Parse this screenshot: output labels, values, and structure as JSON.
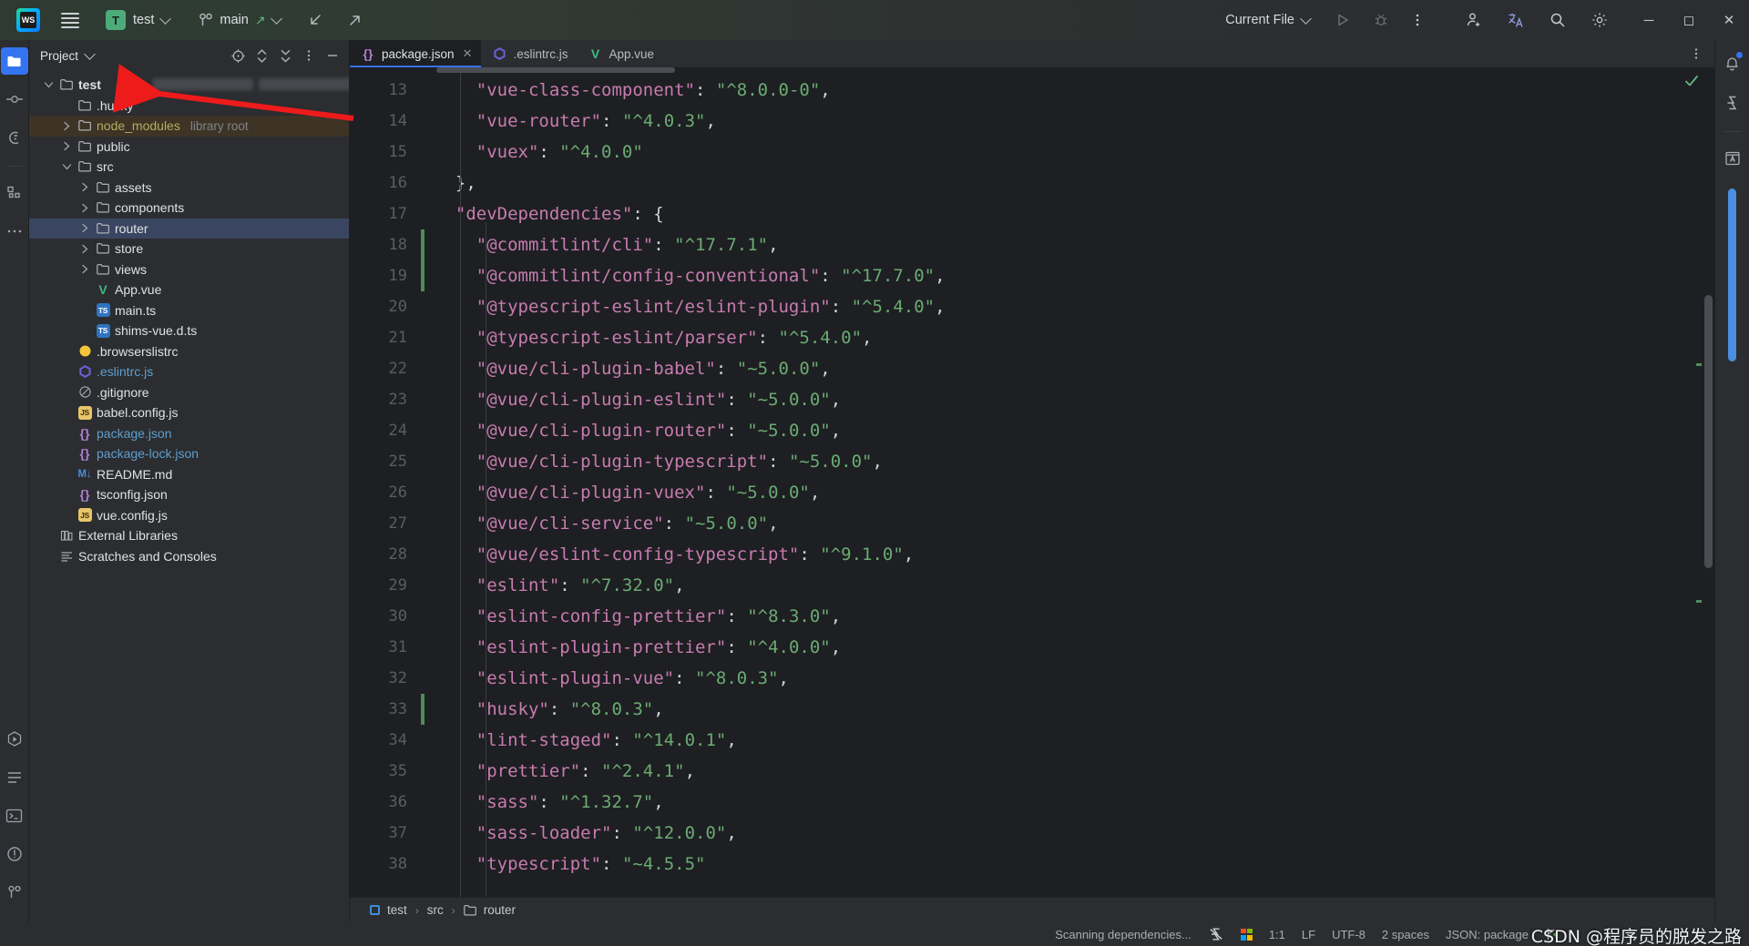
{
  "titlebar": {
    "app_icon": "webstorm-logo",
    "menu_icon": "hamburger-menu-icon",
    "project_badge": "T",
    "project_name": "test",
    "vcs_icon": "git-branch-icon",
    "branch_name": "main",
    "push_icon": "arrow-up-right-icon",
    "update_icon": "arrow-down-left-icon",
    "share_icon": "arrow-up-right-icon",
    "run_config_label": "Current File",
    "run_icon": "run-triangle-icon",
    "debug_icon": "debug-bug-icon",
    "more_icon": "more-vertical-icon",
    "account_icon": "add-user-icon",
    "translate_icon": "translate-icon",
    "search_icon": "search-icon",
    "settings_icon": "gear-icon",
    "minimize_icon": "minimize-icon",
    "maximize_icon": "maximize-icon",
    "close_icon": "close-icon"
  },
  "left_rail": {
    "top": [
      {
        "name": "project-tool-window",
        "icon": "folder-icon",
        "active": true
      },
      {
        "name": "commit-tool-window",
        "icon": "commit-node-icon",
        "active": false
      },
      {
        "name": "cyclone-tool-window",
        "icon": "cyclone-icon",
        "active": false
      },
      {
        "name": "structure-tool-window",
        "icon": "structure-blocks-icon",
        "active": false
      },
      {
        "name": "more-tool-windows",
        "icon": "ellipsis-icon",
        "active": false
      }
    ],
    "bottom": [
      {
        "name": "run-tool-window",
        "icon": "run-hex-icon"
      },
      {
        "name": "todo-tool-window",
        "icon": "lines-icon"
      },
      {
        "name": "terminal-tool-window",
        "icon": "terminal-icon"
      },
      {
        "name": "problems-tool-window",
        "icon": "warning-circle-icon"
      },
      {
        "name": "git-tool-window",
        "icon": "git-branch-icon"
      }
    ]
  },
  "project_panel": {
    "title": "Project",
    "title_chevron": "chevron-down-icon",
    "actions": [
      {
        "name": "select-opened-file",
        "icon": "target-icon"
      },
      {
        "name": "expand-collapse",
        "icon": "expand-collapse-icon"
      },
      {
        "name": "collapse-all",
        "icon": "collapse-all-icon"
      },
      {
        "name": "panel-options",
        "icon": "more-vertical-icon"
      },
      {
        "name": "hide-panel",
        "icon": "minimize-icon"
      }
    ],
    "tree": [
      {
        "label": "test",
        "depth": 0,
        "twisty": "down",
        "icon": "folder-icon",
        "bold": true,
        "style": "plain",
        "masked": true
      },
      {
        "label": ".husky",
        "depth": 1,
        "twisty": "none",
        "icon": "folder-icon",
        "bold": false,
        "style": "plain"
      },
      {
        "label": "node_modules",
        "depth": 1,
        "twisty": "right",
        "icon": "folder-icon",
        "bold": false,
        "style": "yellow",
        "suffix": "library root",
        "libroot": true
      },
      {
        "label": "public",
        "depth": 1,
        "twisty": "right",
        "icon": "folder-icon",
        "bold": false,
        "style": "plain"
      },
      {
        "label": "src",
        "depth": 1,
        "twisty": "down",
        "icon": "folder-icon",
        "bold": false,
        "style": "plain"
      },
      {
        "label": "assets",
        "depth": 2,
        "twisty": "right",
        "icon": "folder-icon",
        "bold": false,
        "style": "plain"
      },
      {
        "label": "components",
        "depth": 2,
        "twisty": "right",
        "icon": "folder-icon",
        "bold": false,
        "style": "plain"
      },
      {
        "label": "router",
        "depth": 2,
        "twisty": "right",
        "icon": "folder-icon",
        "bold": false,
        "style": "plain",
        "selected": true
      },
      {
        "label": "store",
        "depth": 2,
        "twisty": "right",
        "icon": "folder-icon",
        "bold": false,
        "style": "plain"
      },
      {
        "label": "views",
        "depth": 2,
        "twisty": "right",
        "icon": "folder-icon",
        "bold": false,
        "style": "plain"
      },
      {
        "label": "App.vue",
        "depth": 2,
        "twisty": "none",
        "icon": "vue-icon",
        "bold": false,
        "style": "plain"
      },
      {
        "label": "main.ts",
        "depth": 2,
        "twisty": "none",
        "icon": "ts-icon",
        "bold": false,
        "style": "plain"
      },
      {
        "label": "shims-vue.d.ts",
        "depth": 2,
        "twisty": "none",
        "icon": "ts-icon",
        "bold": false,
        "style": "plain"
      },
      {
        "label": ".browserslistrc",
        "depth": 1,
        "twisty": "none",
        "icon": "browserslist-icon",
        "bold": false,
        "style": "plain"
      },
      {
        "label": ".eslintrc.js",
        "depth": 1,
        "twisty": "none",
        "icon": "eslint-icon",
        "bold": false,
        "style": "blue"
      },
      {
        "label": ".gitignore",
        "depth": 1,
        "twisty": "none",
        "icon": "gitignore-icon",
        "bold": false,
        "style": "plain"
      },
      {
        "label": "babel.config.js",
        "depth": 1,
        "twisty": "none",
        "icon": "js-icon",
        "bold": false,
        "style": "plain"
      },
      {
        "label": "package.json",
        "depth": 1,
        "twisty": "none",
        "icon": "json-icon",
        "bold": false,
        "style": "blue"
      },
      {
        "label": "package-lock.json",
        "depth": 1,
        "twisty": "none",
        "icon": "json-icon",
        "bold": false,
        "style": "blue"
      },
      {
        "label": "README.md",
        "depth": 1,
        "twisty": "none",
        "icon": "markdown-icon",
        "bold": false,
        "style": "plain"
      },
      {
        "label": "tsconfig.json",
        "depth": 1,
        "twisty": "none",
        "icon": "json-icon",
        "bold": false,
        "style": "plain"
      },
      {
        "label": "vue.config.js",
        "depth": 1,
        "twisty": "none",
        "icon": "js-icon",
        "bold": false,
        "style": "plain"
      },
      {
        "label": "External Libraries",
        "depth": 0,
        "twisty": "none",
        "icon": "library-icon",
        "bold": false,
        "style": "plain"
      },
      {
        "label": "Scratches and Consoles",
        "depth": 0,
        "twisty": "none",
        "icon": "scratches-icon",
        "bold": false,
        "style": "plain"
      }
    ],
    "annotation": {
      "type": "red-arrow",
      "points_to": ".husky"
    }
  },
  "tabs": [
    {
      "label": "package.json",
      "icon": "json-icon",
      "active": true,
      "closable": true
    },
    {
      "label": ".eslintrc.js",
      "icon": "eslint-icon",
      "active": false,
      "closable": false
    },
    {
      "label": "App.vue",
      "icon": "vue-icon",
      "active": false,
      "closable": false
    }
  ],
  "editor": {
    "first_line_number": 13,
    "lines": [
      {
        "n": 13,
        "indent": 4,
        "key": "\"vue-class-component\"",
        "sep": ": ",
        "val": "\"^8.0.0-0\"",
        "tail": ","
      },
      {
        "n": 14,
        "indent": 4,
        "key": "\"vue-router\"",
        "sep": ": ",
        "val": "\"^4.0.3\"",
        "tail": ","
      },
      {
        "n": 15,
        "indent": 4,
        "key": "\"vuex\"",
        "sep": ": ",
        "val": "\"^4.0.0\"",
        "tail": ""
      },
      {
        "n": 16,
        "indent": 2,
        "raw": "},"
      },
      {
        "n": 17,
        "indent": 2,
        "key": "\"devDependencies\"",
        "sep": ": ",
        "raw_tail": "{"
      },
      {
        "n": 18,
        "indent": 4,
        "key": "\"@commitlint/cli\"",
        "sep": ": ",
        "val": "\"^17.7.1\"",
        "tail": ","
      },
      {
        "n": 19,
        "indent": 4,
        "key": "\"@commitlint/config-conventional\"",
        "sep": ": ",
        "val": "\"^17.7.0\"",
        "tail": ","
      },
      {
        "n": 20,
        "indent": 4,
        "key": "\"@typescript-eslint/eslint-plugin\"",
        "sep": ": ",
        "val": "\"^5.4.0\"",
        "tail": ","
      },
      {
        "n": 21,
        "indent": 4,
        "key": "\"@typescript-eslint/parser\"",
        "sep": ": ",
        "val": "\"^5.4.0\"",
        "tail": ","
      },
      {
        "n": 22,
        "indent": 4,
        "key": "\"@vue/cli-plugin-babel\"",
        "sep": ": ",
        "val": "\"~5.0.0\"",
        "tail": ","
      },
      {
        "n": 23,
        "indent": 4,
        "key": "\"@vue/cli-plugin-eslint\"",
        "sep": ": ",
        "val": "\"~5.0.0\"",
        "tail": ","
      },
      {
        "n": 24,
        "indent": 4,
        "key": "\"@vue/cli-plugin-router\"",
        "sep": ": ",
        "val": "\"~5.0.0\"",
        "tail": ","
      },
      {
        "n": 25,
        "indent": 4,
        "key": "\"@vue/cli-plugin-typescript\"",
        "sep": ": ",
        "val": "\"~5.0.0\"",
        "tail": ","
      },
      {
        "n": 26,
        "indent": 4,
        "key": "\"@vue/cli-plugin-vuex\"",
        "sep": ": ",
        "val": "\"~5.0.0\"",
        "tail": ","
      },
      {
        "n": 27,
        "indent": 4,
        "key": "\"@vue/cli-service\"",
        "sep": ": ",
        "val": "\"~5.0.0\"",
        "tail": ","
      },
      {
        "n": 28,
        "indent": 4,
        "key": "\"@vue/eslint-config-typescript\"",
        "sep": ": ",
        "val": "\"^9.1.0\"",
        "tail": ","
      },
      {
        "n": 29,
        "indent": 4,
        "key": "\"eslint\"",
        "sep": ": ",
        "val": "\"^7.32.0\"",
        "tail": ","
      },
      {
        "n": 30,
        "indent": 4,
        "key": "\"eslint-config-prettier\"",
        "sep": ": ",
        "val": "\"^8.3.0\"",
        "tail": ","
      },
      {
        "n": 31,
        "indent": 4,
        "key": "\"eslint-plugin-prettier\"",
        "sep": ": ",
        "val": "\"^4.0.0\"",
        "tail": ","
      },
      {
        "n": 32,
        "indent": 4,
        "key": "\"eslint-plugin-vue\"",
        "sep": ": ",
        "val": "\"^8.0.3\"",
        "tail": ","
      },
      {
        "n": 33,
        "indent": 4,
        "key": "\"husky\"",
        "sep": ": ",
        "val": "\"^8.0.3\"",
        "tail": ","
      },
      {
        "n": 34,
        "indent": 4,
        "key": "\"lint-staged\"",
        "sep": ": ",
        "val": "\"^14.0.1\"",
        "tail": ","
      },
      {
        "n": 35,
        "indent": 4,
        "key": "\"prettier\"",
        "sep": ": ",
        "val": "\"^2.4.1\"",
        "tail": ","
      },
      {
        "n": 36,
        "indent": 4,
        "key": "\"sass\"",
        "sep": ": ",
        "val": "\"^1.32.7\"",
        "tail": ","
      },
      {
        "n": 37,
        "indent": 4,
        "key": "\"sass-loader\"",
        "sep": ": ",
        "val": "\"^12.0.0\"",
        "tail": ","
      },
      {
        "n": 38,
        "indent": 4,
        "key": "\"typescript\"",
        "sep": ": ",
        "val": "\"~4.5.5\"",
        "tail": ""
      }
    ],
    "inspection_status": "ok-check",
    "changed_line_markers": [
      18,
      19,
      33
    ]
  },
  "right_rail": [
    {
      "name": "notifications",
      "icon": "bell-icon",
      "badge": true
    },
    {
      "name": "cyclone-tool",
      "icon": "cyclone-icon",
      "badge": false
    },
    {
      "name": "translation-tool",
      "icon": "dictionary-a-icon",
      "badge": false
    }
  ],
  "breadcrumb": [
    {
      "label": "test",
      "icon": "module-icon"
    },
    {
      "label": "src",
      "icon": "none"
    },
    {
      "label": "router",
      "icon": "folder-icon"
    }
  ],
  "status_bar": {
    "message": "Scanning dependencies...",
    "cyclone_icon": "cyclone-icon",
    "os_icon": "windows-icon",
    "caret_position": "1:1",
    "line_separator": "LF",
    "encoding": "UTF-8",
    "indent": "2 spaces",
    "schema": "JSON: package",
    "vcs_icon": "git-branch-icon",
    "watermark": "CSDN @程序员的脱发之路"
  },
  "colors": {
    "accent_blue": "#3574f0",
    "selection_blue": "#3a4661",
    "library_root_bg": "#3d3426",
    "editor_bg": "#1e1f22",
    "panel_bg": "#2b2d30",
    "string_green": "#6aab73",
    "key_pink": "#c77cb0",
    "vue_green": "#41b883",
    "annotation_red": "#ee1b1b"
  }
}
